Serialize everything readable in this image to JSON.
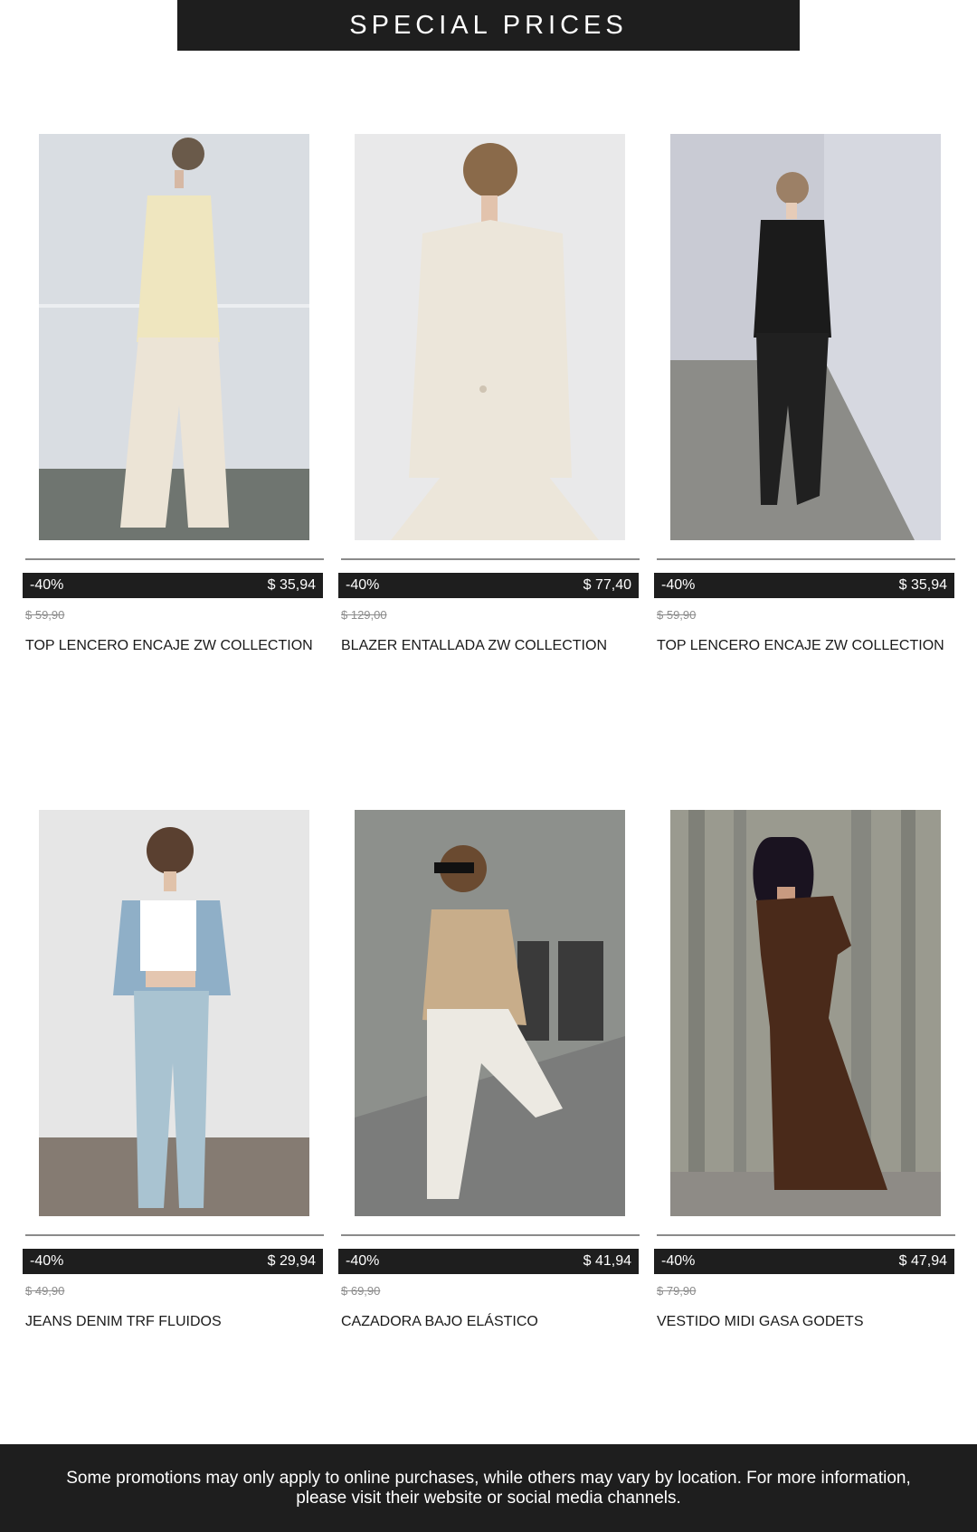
{
  "header": {
    "title": "SPECIAL PRICES"
  },
  "products": [
    {
      "discount": "-40%",
      "price": "$ 35,94",
      "old_price": "$ 59,90",
      "name": "TOP LENCERO ENCAJE ZW COLLECTION",
      "photo": {
        "bg": "#d9dde2",
        "floor": "#6f7570",
        "outfit": "#efe6bf",
        "pants": "#ece4d6"
      }
    },
    {
      "discount": "-40%",
      "price": "$ 77,40",
      "old_price": "$ 129,00",
      "name": "BLAZER ENTALLADA ZW COLLECTION",
      "photo": {
        "bg": "#e9e9ea",
        "floor": "#e9e9ea",
        "outfit": "#ece6da",
        "pants": "#ece6da"
      }
    },
    {
      "discount": "-40%",
      "price": "$ 35,94",
      "old_price": "$ 59,90",
      "name": "TOP LENCERO ENCAJE ZW COLLECTION",
      "photo": {
        "bg": "#c9cbd4",
        "floor": "#8c8c88",
        "outfit": "#1b1b1b",
        "pants": "#202020"
      }
    },
    {
      "discount": "-40%",
      "price": "$ 29,94",
      "old_price": "$ 49,90",
      "name": "JEANS DENIM TRF FLUIDOS",
      "photo": {
        "bg": "#e6e6e6",
        "floor": "#857b72",
        "outfit": "#8fafc7",
        "pants": "#a9c3d1"
      }
    },
    {
      "discount": "-40%",
      "price": "$ 41,94",
      "old_price": "$ 69,90",
      "name": "CAZADORA BAJO ELÁSTICO",
      "photo": {
        "bg": "#8d908c",
        "floor": "#7b7c7b",
        "outfit": "#c8ad8a",
        "pants": "#ece9e2"
      }
    },
    {
      "discount": "-40%",
      "price": "$ 47,94",
      "old_price": "$ 79,90",
      "name": "VESTIDO MIDI GASA GODETS",
      "photo": {
        "bg": "#9a9a8f",
        "floor": "#8e8b86",
        "outfit": "#4a2a1a",
        "pants": "#4a2a1a"
      }
    }
  ],
  "footer": {
    "text": "Some promotions may only apply to online purchases, while others may vary by location. For more information, please visit their website or social media channels."
  }
}
